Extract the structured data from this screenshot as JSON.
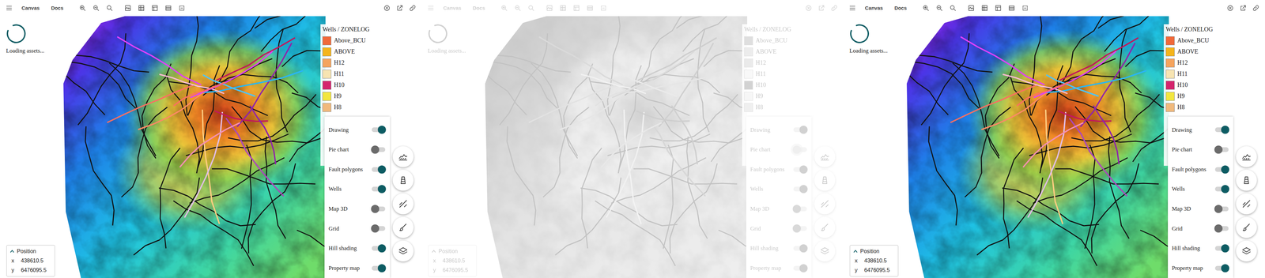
{
  "panels": [
    {
      "faded": false,
      "toolbar": {
        "tabs": [
          "Canvas",
          "Docs"
        ]
      },
      "loading": "Loading assets...",
      "legend": {
        "title": "Wells / ZONELOG",
        "items": [
          {
            "label": "Above_BCU",
            "color": "#f0693a"
          },
          {
            "label": "ABOVE",
            "color": "#f4b41c"
          },
          {
            "label": "H12",
            "color": "#f5a45e"
          },
          {
            "label": "H11",
            "color": "#f7e4b2"
          },
          {
            "label": "H10",
            "color": "#d4246c"
          },
          {
            "label": "H9",
            "color": "#f2e63f"
          },
          {
            "label": "H8",
            "color": "#f0b97c"
          }
        ]
      },
      "layers": [
        {
          "label": "Drawing",
          "on": true,
          "focused": false
        },
        {
          "label": "Pie chart",
          "on": false,
          "focused": false
        },
        {
          "label": "Fault polygons",
          "on": true,
          "focused": false
        },
        {
          "label": "Wells",
          "on": true,
          "focused": false
        },
        {
          "label": "Map 3D",
          "on": false,
          "focused": false
        },
        {
          "label": "Grid",
          "on": false,
          "focused": false
        },
        {
          "label": "Hill shading",
          "on": true,
          "focused": false
        },
        {
          "label": "Property map",
          "on": true,
          "focused": false
        }
      ],
      "position": {
        "title": "Position",
        "x_label": "x",
        "x": "438610.5",
        "y_label": "y",
        "y": "6476095.5"
      }
    },
    {
      "faded": true,
      "toolbar": {
        "tabs": [
          "Canvas",
          "Docs"
        ]
      },
      "loading": "Loading assets...",
      "legend": {
        "title": "Wells / ZONELOG",
        "items": [
          {
            "label": "Above_BCU",
            "color": "#f0693a"
          },
          {
            "label": "ABOVE",
            "color": "#f4b41c"
          },
          {
            "label": "H12",
            "color": "#f5a45e"
          },
          {
            "label": "H11",
            "color": "#f7e4b2"
          },
          {
            "label": "H10",
            "color": "#d4246c"
          },
          {
            "label": "H9",
            "color": "#f2e63f"
          },
          {
            "label": "H8",
            "color": "#f0b97c"
          }
        ]
      },
      "layers": [
        {
          "label": "Drawing",
          "on": true,
          "focused": false
        },
        {
          "label": "Pie chart",
          "on": false,
          "focused": true
        },
        {
          "label": "Fault polygons",
          "on": true,
          "focused": false
        },
        {
          "label": "Wells",
          "on": true,
          "focused": false
        },
        {
          "label": "Map 3D",
          "on": false,
          "focused": false
        },
        {
          "label": "Grid",
          "on": false,
          "focused": false
        },
        {
          "label": "Hill shading",
          "on": true,
          "focused": false
        },
        {
          "label": "Property map",
          "on": true,
          "focused": false
        }
      ],
      "position": {
        "title": "Position",
        "x_label": "x",
        "x": "438610.5",
        "y_label": "y",
        "y": "6476095.5"
      }
    },
    {
      "faded": false,
      "toolbar": {
        "tabs": [
          "Canvas",
          "Docs"
        ]
      },
      "loading": "Loading assets...",
      "legend": {
        "title": "Wells / ZONELOG",
        "items": [
          {
            "label": "Above_BCU",
            "color": "#f0693a"
          },
          {
            "label": "ABOVE",
            "color": "#f4b41c"
          },
          {
            "label": "H12",
            "color": "#f5a45e"
          },
          {
            "label": "H11",
            "color": "#f7e4b2"
          },
          {
            "label": "H10",
            "color": "#d4246c"
          },
          {
            "label": "H9",
            "color": "#f2e63f"
          },
          {
            "label": "H8",
            "color": "#f0b97c"
          }
        ]
      },
      "layers": [
        {
          "label": "Drawing",
          "on": true,
          "focused": false
        },
        {
          "label": "Pie chart",
          "on": false,
          "focused": false
        },
        {
          "label": "Fault polygons",
          "on": true,
          "focused": false
        },
        {
          "label": "Wells",
          "on": true,
          "focused": false
        },
        {
          "label": "Map 3D",
          "on": false,
          "focused": false
        },
        {
          "label": "Grid",
          "on": false,
          "focused": false
        },
        {
          "label": "Hill shading",
          "on": true,
          "focused": false
        },
        {
          "label": "Property map",
          "on": true,
          "focused": false
        }
      ],
      "position": {
        "title": "Position",
        "x_label": "x",
        "x": "438610.5",
        "y_label": "y",
        "y": "6476095.5"
      }
    }
  ]
}
